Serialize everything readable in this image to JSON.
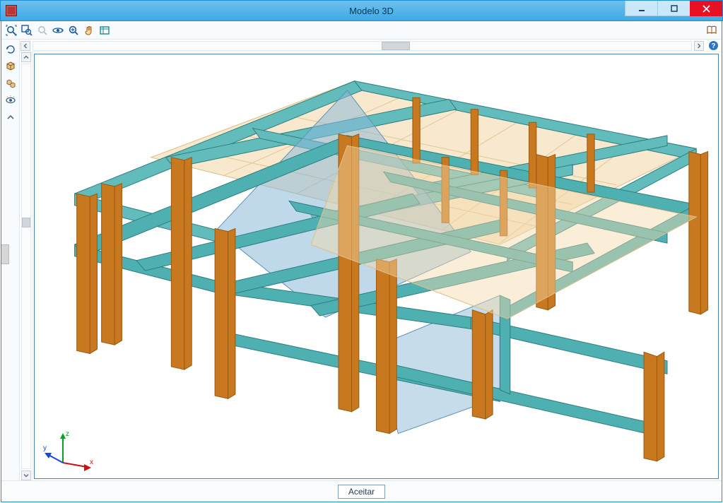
{
  "window": {
    "title": "Modelo 3D",
    "colors": {
      "titlebar": "#3fa9e4",
      "close": "#e81123"
    }
  },
  "toolbar_top": {
    "icons": [
      "zoom-extents-icon",
      "zoom-window-icon",
      "zoom-previous-icon",
      "orbit-icon",
      "zoom-in-icon",
      "pan-hand-icon",
      "box-icon"
    ],
    "help_icon": "help-book-icon"
  },
  "toolbar_side": {
    "icons": [
      "rotate-icon",
      "cube-icon",
      "cubes-icon",
      "eye-icon",
      "collapse-up-icon"
    ]
  },
  "hscroll": {
    "help_icon": "help-question-icon"
  },
  "axis": {
    "x": "x",
    "y": "y",
    "z": "z"
  },
  "footer": {
    "accept_label": "Aceitar"
  },
  "model_colors": {
    "beam": "#4fb0b2",
    "beam_shadow": "#2e7f80",
    "column": "#c8781e",
    "column_shadow": "#9a5a14",
    "slab": "#f3d9ab",
    "slab_edge": "#dcc08a",
    "glass": "#8db9d8"
  }
}
